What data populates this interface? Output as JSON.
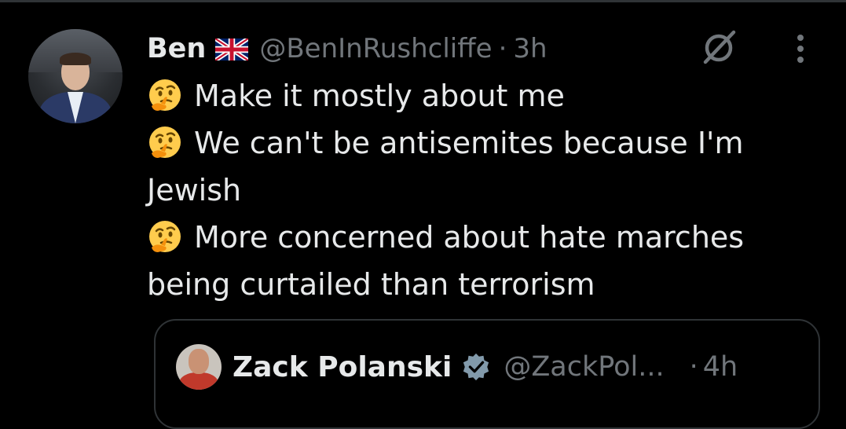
{
  "tweet": {
    "author_name": "Ben",
    "author_flag": "uk-flag-icon",
    "handle": "@BenInRushcliffe",
    "separator": "·",
    "time": "3h",
    "lines": [
      {
        "emoji": "thinking-face-emoji",
        "text": "Make it mostly about me"
      },
      {
        "emoji": "thinking-face-emoji",
        "text": "We can't be antisemites because I'm"
      },
      {
        "emoji": null,
        "text": "Jewish"
      },
      {
        "emoji": "thinking-face-emoji",
        "text": "More concerned about hate marches"
      },
      {
        "emoji": null,
        "text": "being curtailed than terrorism"
      }
    ]
  },
  "quoted_tweet": {
    "author_name": "Zack Polanski",
    "verified_icon": "verified-badge-icon",
    "handle": "@ZackPol...",
    "separator": "·",
    "time": "4h"
  },
  "colors": {
    "background": "#000000",
    "primary_text": "#e7e9ea",
    "secondary_text": "#71767b",
    "border": "#2f3336",
    "verified_badge": "#829aab"
  }
}
